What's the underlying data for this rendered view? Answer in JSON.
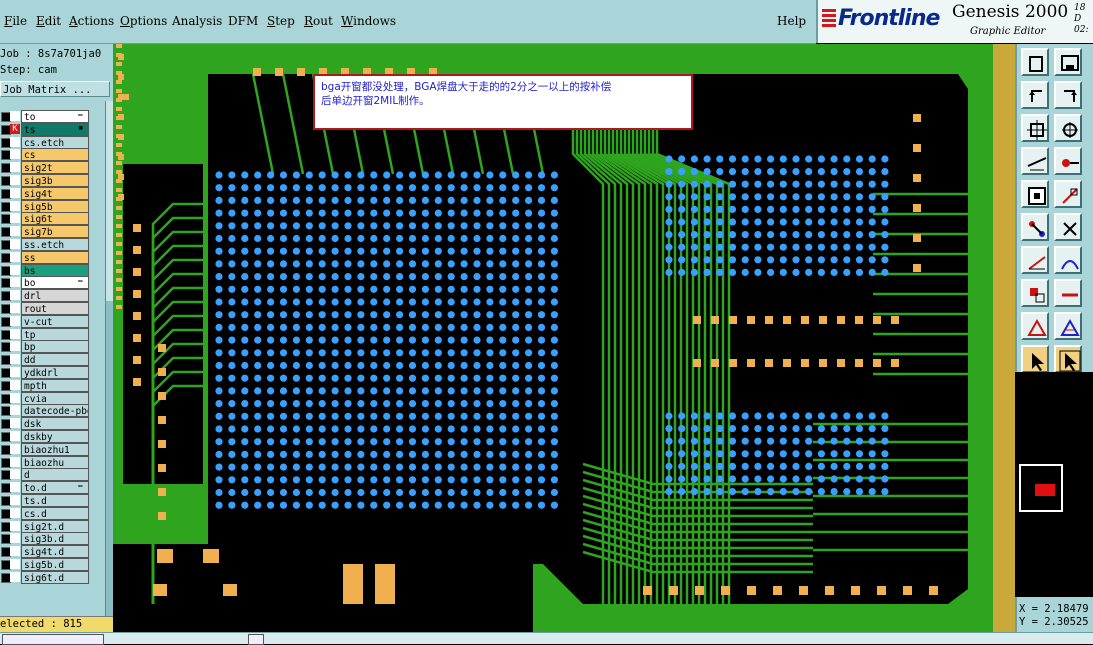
{
  "menu": {
    "items": [
      {
        "label": "File",
        "underline": "F",
        "rest": "ile"
      },
      {
        "label": "Edit",
        "underline": "E",
        "rest": "dit"
      },
      {
        "label": "Actions",
        "underline": "A",
        "rest": "ctions"
      },
      {
        "label": "Options",
        "underline": "O",
        "rest": "ptions"
      },
      {
        "label": "Analysis",
        "underline": "",
        "rest": "Analysis"
      },
      {
        "label": "DFM",
        "underline": "",
        "rest": "DFM"
      },
      {
        "label": "Step",
        "underline": "S",
        "rest": "tep"
      },
      {
        "label": "Rout",
        "underline": "R",
        "rest": "out"
      },
      {
        "label": "Windows",
        "underline": "W",
        "rest": "indows"
      }
    ],
    "help": "Help"
  },
  "branding": {
    "company": "Frontline",
    "product": "Genesis 2000",
    "subtitle": "Graphic Editor",
    "date": "18 D",
    "time": "02:"
  },
  "job": {
    "job_line": "Job : 8s7a701ja0",
    "step_line": "Step: cam",
    "matrix_button": "Job Matrix ..."
  },
  "layers": [
    {
      "name": "to",
      "bg": "#ffffff",
      "color": "#ffffff",
      "flag": "✏"
    },
    {
      "name": "ts",
      "bg": "#0f7a6a",
      "color": "#d81818",
      "flag": "▪",
      "mark": "K"
    },
    {
      "name": "cs.etch",
      "bg": "#b9d8db",
      "color": "#ffffff",
      "flag": ""
    },
    {
      "name": "cs",
      "bg": "#f5c96b",
      "color": "#ffffff",
      "flag": ""
    },
    {
      "name": "sig2t",
      "bg": "#f5c96b",
      "color": "#ffffff",
      "flag": ""
    },
    {
      "name": "sig3b",
      "bg": "#f5c96b",
      "color": "#ffffff",
      "flag": ""
    },
    {
      "name": "sig4t",
      "bg": "#f5c96b",
      "color": "#ffffff",
      "flag": ""
    },
    {
      "name": "sig5b",
      "bg": "#f5c96b",
      "color": "#ffffff",
      "flag": ""
    },
    {
      "name": "sig6t",
      "bg": "#f5c96b",
      "color": "#ffffff",
      "flag": ""
    },
    {
      "name": "sig7b",
      "bg": "#f5c96b",
      "color": "#ffffff",
      "flag": ""
    },
    {
      "name": "ss.etch",
      "bg": "#b9d8db",
      "color": "#ffffff",
      "flag": ""
    },
    {
      "name": "ss",
      "bg": "#f5c96b",
      "color": "#ffffff",
      "flag": ""
    },
    {
      "name": "bs",
      "bg": "#1aa07e",
      "color": "#ffffff",
      "flag": ""
    },
    {
      "name": "bo",
      "bg": "#ffffff",
      "color": "#ffffff",
      "flag": "✏"
    },
    {
      "name": "drl",
      "bg": "#d6d6d6",
      "color": "#ffffff",
      "flag": ""
    },
    {
      "name": "rout",
      "bg": "#d6d6d6",
      "color": "#ffffff",
      "flag": ""
    },
    {
      "name": "v-cut",
      "bg": "#b9d8db",
      "color": "#ffffff",
      "flag": ""
    },
    {
      "name": "tp",
      "bg": "#b9d8db",
      "color": "#ffffff",
      "flag": ""
    },
    {
      "name": "bp",
      "bg": "#b9d8db",
      "color": "#ffffff",
      "flag": ""
    },
    {
      "name": "dd",
      "bg": "#b9d8db",
      "color": "#ffffff",
      "flag": ""
    },
    {
      "name": "ydkdrl",
      "bg": "#b9d8db",
      "color": "#ffffff",
      "flag": ""
    },
    {
      "name": "mpth",
      "bg": "#b9d8db",
      "color": "#ffffff",
      "flag": ""
    },
    {
      "name": "cvia",
      "bg": "#b9d8db",
      "color": "#ffffff",
      "flag": ""
    },
    {
      "name": "datecode-pbe",
      "bg": "#b9d8db",
      "color": "#ffffff",
      "flag": ""
    },
    {
      "name": "dsk",
      "bg": "#b9d8db",
      "color": "#ffffff",
      "flag": ""
    },
    {
      "name": "dskby",
      "bg": "#b9d8db",
      "color": "#ffffff",
      "flag": ""
    },
    {
      "name": "biaozhu1",
      "bg": "#b9d8db",
      "color": "#ffffff",
      "flag": ""
    },
    {
      "name": "biaozhu",
      "bg": "#b9d8db",
      "color": "#ffffff",
      "flag": ""
    },
    {
      "name": "d",
      "bg": "#b9d8db",
      "color": "#ffffff",
      "flag": ""
    },
    {
      "name": "to.d",
      "bg": "#b9d8db",
      "color": "#ffffff",
      "flag": "✏"
    },
    {
      "name": "ts.d",
      "bg": "#b9d8db",
      "color": "#ffffff",
      "flag": ""
    },
    {
      "name": "cs.d",
      "bg": "#b9d8db",
      "color": "#ffffff",
      "flag": ""
    },
    {
      "name": "sig2t.d",
      "bg": "#b9d8db",
      "color": "#ffffff",
      "flag": ""
    },
    {
      "name": "sig3b.d",
      "bg": "#b9d8db",
      "color": "#ffffff",
      "flag": ""
    },
    {
      "name": "sig4t.d",
      "bg": "#b9d8db",
      "color": "#ffffff",
      "flag": ""
    },
    {
      "name": "sig5b.d",
      "bg": "#b9d8db",
      "color": "#ffffff",
      "flag": ""
    },
    {
      "name": "sig6t.d",
      "bg": "#b9d8db",
      "color": "#ffffff",
      "flag": ""
    }
  ],
  "status": {
    "selected": "elected : 815"
  },
  "popup": {
    "line1": "bga开窗都没处理，BGA焊盘大于走的的2分之一以上的按补偿",
    "line2": "后单边开窗2MIL制作。"
  },
  "coords": {
    "x": "X = 2.18479",
    "y": "Y = 2.30525"
  },
  "tools": [
    "copy-icon",
    "save-icon",
    "undo-icon",
    "redo-icon",
    "zoom-fit-icon",
    "zoom-icon",
    "measure-icon",
    "key-icon",
    "select-box-icon",
    "edit-shape-icon",
    "add-pad-icon",
    "delete-icon",
    "line-icon",
    "arc-icon",
    "move-icon",
    "resize-icon",
    "triangle-icon",
    "polygon-icon",
    "pointer-icon",
    "pointer-alt-icon"
  ],
  "colors": {
    "panel": "#a9d4d8",
    "board": "#2fa51f",
    "pad": "#f0b050",
    "via": "#3aa0ff",
    "popup_border": "#b4161b"
  }
}
